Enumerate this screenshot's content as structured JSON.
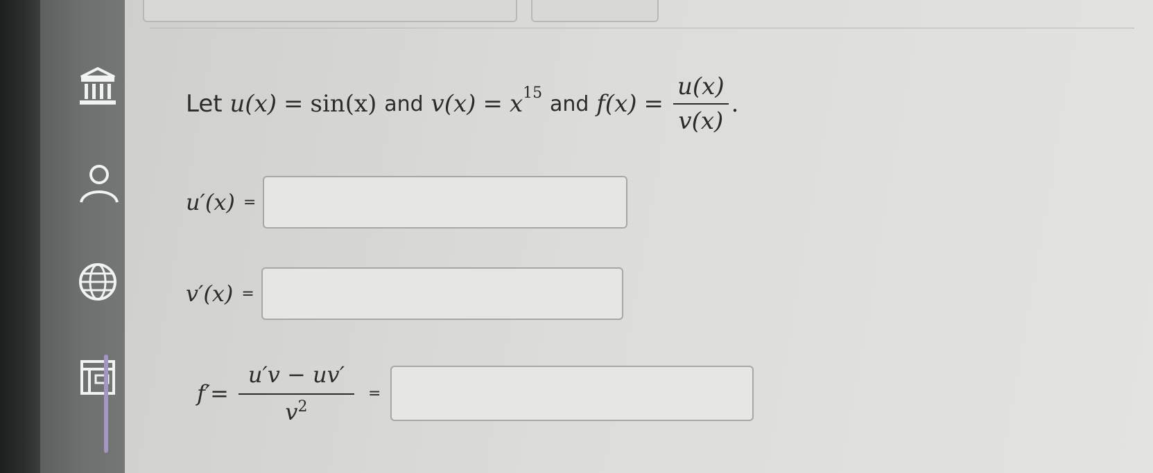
{
  "sidebar": {
    "icons": [
      "institution-icon",
      "user-icon",
      "globe-icon",
      "calculator-icon"
    ]
  },
  "problem": {
    "let_text": "Let",
    "u_def_lhs": "u(x)",
    "u_def_rhs": "sin(x)",
    "and1": "and",
    "v_def_lhs": "v(x)",
    "v_def_base": "x",
    "v_def_exp": "15",
    "and2": "and",
    "f_def_lhs": "f(x)",
    "f_num": "u(x)",
    "f_den": "v(x)",
    "period": "."
  },
  "rows": {
    "u_prime_label": "u′(x)",
    "u_prime_eq": "=",
    "u_prime_value": "",
    "v_prime_label": "v′(x)",
    "v_prime_eq": "=",
    "v_prime_value": "",
    "f_prime_label": "f′=",
    "f_prime_num": "u′v − uv′",
    "f_prime_den_base": "v",
    "f_prime_den_exp": "2",
    "f_prime_eq": "=",
    "f_prime_value": ""
  },
  "colors": {
    "sidebar": "#6c706e",
    "active_indicator": "#a395c4",
    "content_bg": "#dcdcd8",
    "text": "#2b2b2b"
  }
}
